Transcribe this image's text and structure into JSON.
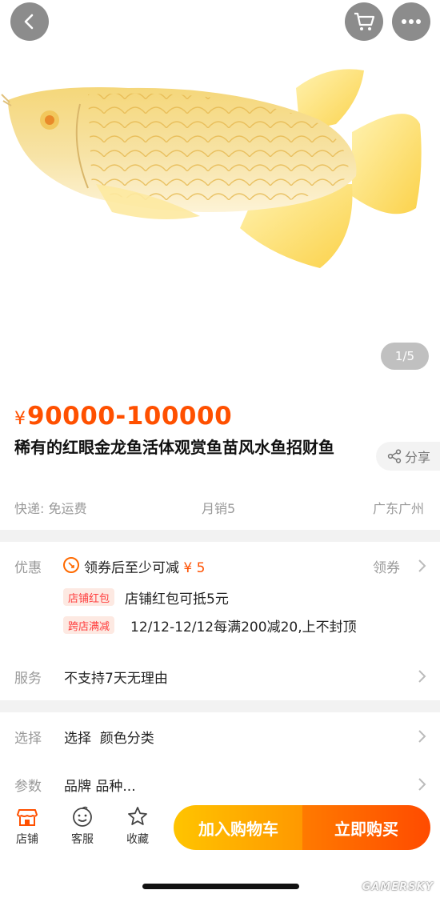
{
  "gallery": {
    "counter": "1/5",
    "image_alt": "golden arowana fish"
  },
  "nav": {
    "back_icon": "chevron-left-icon",
    "cart_icon": "cart-icon",
    "more_icon": "more-dots-icon"
  },
  "product": {
    "currency": "¥",
    "price": "90000-100000",
    "title": "稀有的红眼金龙鱼活体观赏鱼苗风水鱼招财鱼",
    "share_label": "分享",
    "shipping": "快递: 免运费",
    "monthly_sales": "月销5",
    "location": "广东广州"
  },
  "promo": {
    "label": "优惠",
    "coupon_text": "领券后至少可减",
    "coupon_amount": "¥ 5",
    "coupon_action": "领券",
    "tags": [
      {
        "tag": "店铺红包",
        "text": "店铺红包可抵5元"
      },
      {
        "tag": "跨店满减",
        "text": "12/12-12/12每满200减20,上不封顶"
      }
    ]
  },
  "service": {
    "label": "服务",
    "text": "不支持7天无理由"
  },
  "select": {
    "label": "选择",
    "text": "选择  颜色分类"
  },
  "params": {
    "label": "参数",
    "text": "品牌 品种..."
  },
  "bottom_bar": {
    "shop": "店铺",
    "service": "客服",
    "favorite": "收藏",
    "add_to_cart": "加入购物车",
    "buy_now": "立即购买"
  },
  "watermark": "GAMERSKY",
  "colors": {
    "price": "#ff5000",
    "cart_btn": "#ffb300",
    "buy_btn": "#ff5a00",
    "tag_bg": "#fde9e2"
  }
}
